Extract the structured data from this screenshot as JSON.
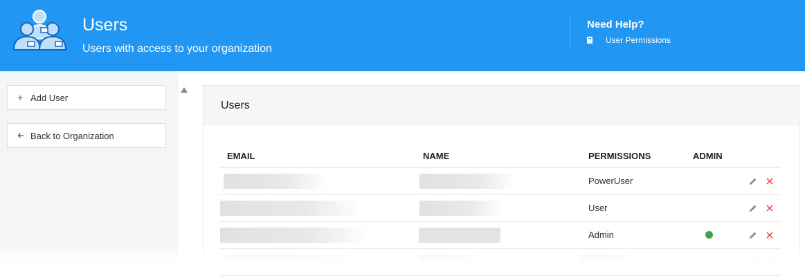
{
  "header": {
    "title": "Users",
    "subtitle": "Users with access to your organization",
    "logo_icon": "users-group-icon",
    "help_title": "Need Help?",
    "help_link": "User Permissions",
    "help_icon": "book-icon",
    "bg_color": "#2196f3"
  },
  "sidebar": {
    "add_user": "Add User",
    "back_to_org": "Back to Organization"
  },
  "panel": {
    "title": "Users",
    "columns": [
      "EMAIL",
      "NAME",
      "PERMISSIONS",
      "ADMIN"
    ],
    "rows": [
      {
        "permission": "PowerUser",
        "admin": false
      },
      {
        "permission": "User",
        "admin": false
      },
      {
        "permission": "Admin",
        "admin": true
      }
    ]
  }
}
